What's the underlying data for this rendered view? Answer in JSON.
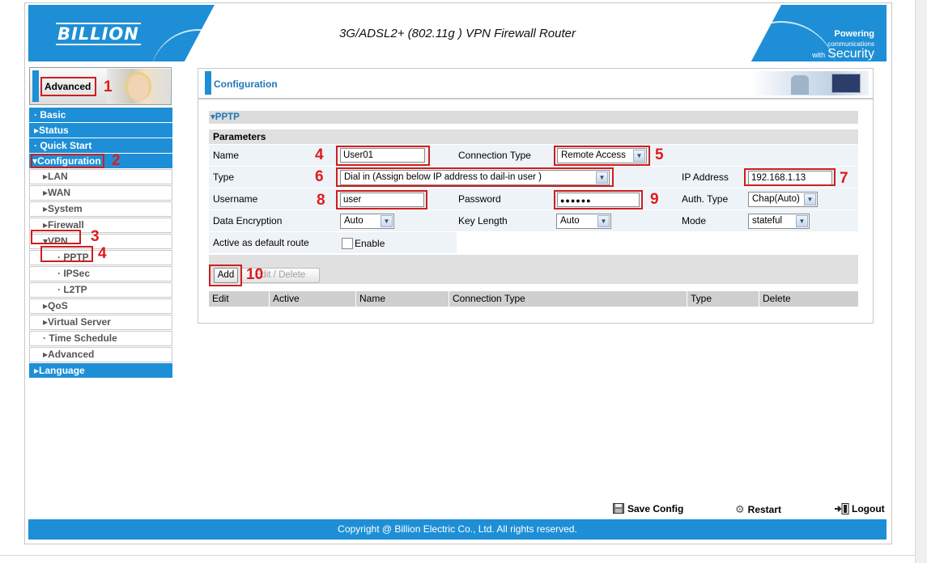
{
  "header": {
    "logo": "BILLION",
    "title": "3G/ADSL2+ (802.11g ) VPN Firewall Router",
    "slogan_line1": "Powering",
    "slogan_line1b": "communications",
    "slogan_line2": "with",
    "slogan_line2b": "Security"
  },
  "sidebar": {
    "advanced_label": "Advanced",
    "items": [
      {
        "label": "· Basic"
      },
      {
        "label": "▸Status"
      },
      {
        "label": "· Quick Start"
      },
      {
        "label": "▾Configuration"
      },
      {
        "label": "▸LAN"
      },
      {
        "label": "▸WAN"
      },
      {
        "label": "▸System"
      },
      {
        "label": "▸Firewall"
      },
      {
        "label": "▾VPN"
      },
      {
        "label": "· PPTP"
      },
      {
        "label": "· IPSec"
      },
      {
        "label": "· L2TP"
      },
      {
        "label": "▸QoS"
      },
      {
        "label": "▸Virtual Server"
      },
      {
        "label": "· Time Schedule"
      },
      {
        "label": "▸Advanced"
      },
      {
        "label": "▸Language"
      }
    ]
  },
  "main": {
    "section_title": "Configuration",
    "panel_title": "▾PPTP",
    "params_title": "Parameters",
    "name_label": "Name",
    "name_value": "User01",
    "conn_type_label": "Connection Type",
    "conn_type_value": "Remote Access",
    "type_label": "Type",
    "type_value": "Dial in (Assign below IP address to dail-in user )",
    "ip_label": "IP Address",
    "ip_value": "192.168.1.13",
    "username_label": "Username",
    "username_value": "user",
    "password_label": "Password",
    "password_value": "●●●●●●",
    "auth_label": "Auth. Type",
    "auth_value": "Chap(Auto)",
    "enc_label": "Data Encryption",
    "enc_value": "Auto",
    "keylen_label": "Key Length",
    "keylen_value": "Auto",
    "mode_label": "Mode",
    "mode_value": "stateful",
    "default_route_label": "Active as default route",
    "enable_label": "Enable",
    "add_button": "Add",
    "edit_delete_button": "Edit / Delete",
    "table_headers": [
      "Edit",
      "Active",
      "Name",
      "Connection Type",
      "Type",
      "Delete"
    ]
  },
  "annotations": [
    "1",
    "2",
    "3",
    "4",
    "4",
    "5",
    "6",
    "7",
    "8",
    "9",
    "10"
  ],
  "footer": {
    "save_config": "Save Config",
    "restart": "Restart",
    "logout": "Logout",
    "copyright": "Copyright @ Billion Electric Co., Ltd. All rights reserved."
  },
  "colors": {
    "brand_blue": "#1e8fd6",
    "annotation_red": "#e01b1b"
  }
}
